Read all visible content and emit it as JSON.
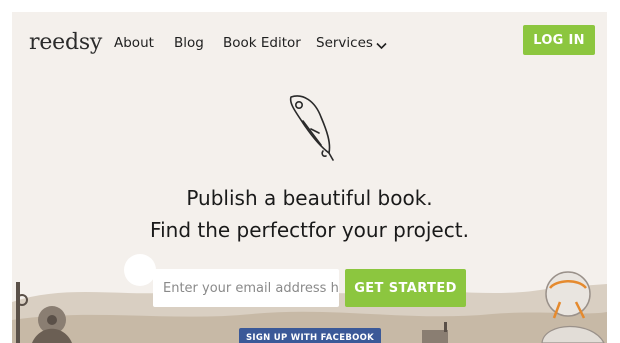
{
  "brand": {
    "logo_text": "reedsy"
  },
  "nav": {
    "items": [
      {
        "label": "About"
      },
      {
        "label": "Blog"
      },
      {
        "label": "Book Editor"
      },
      {
        "label": "Services"
      }
    ],
    "login_label": "LOG IN"
  },
  "hero": {
    "line1": "Publish a beautiful book.",
    "line2": "Find the perfectfor your project."
  },
  "signup": {
    "email_placeholder": "Enter your email address here",
    "cta_label": "GET STARTED",
    "facebook_label": "SIGN UP WITH FACEBOOK"
  },
  "colors": {
    "accent": "#8cc63f",
    "background": "#f4f0ec",
    "facebook": "#3b5998",
    "text": "#1a1a1a"
  },
  "icons": {
    "hero": "quill-icon",
    "services_toggle": "chevron-down-icon"
  }
}
